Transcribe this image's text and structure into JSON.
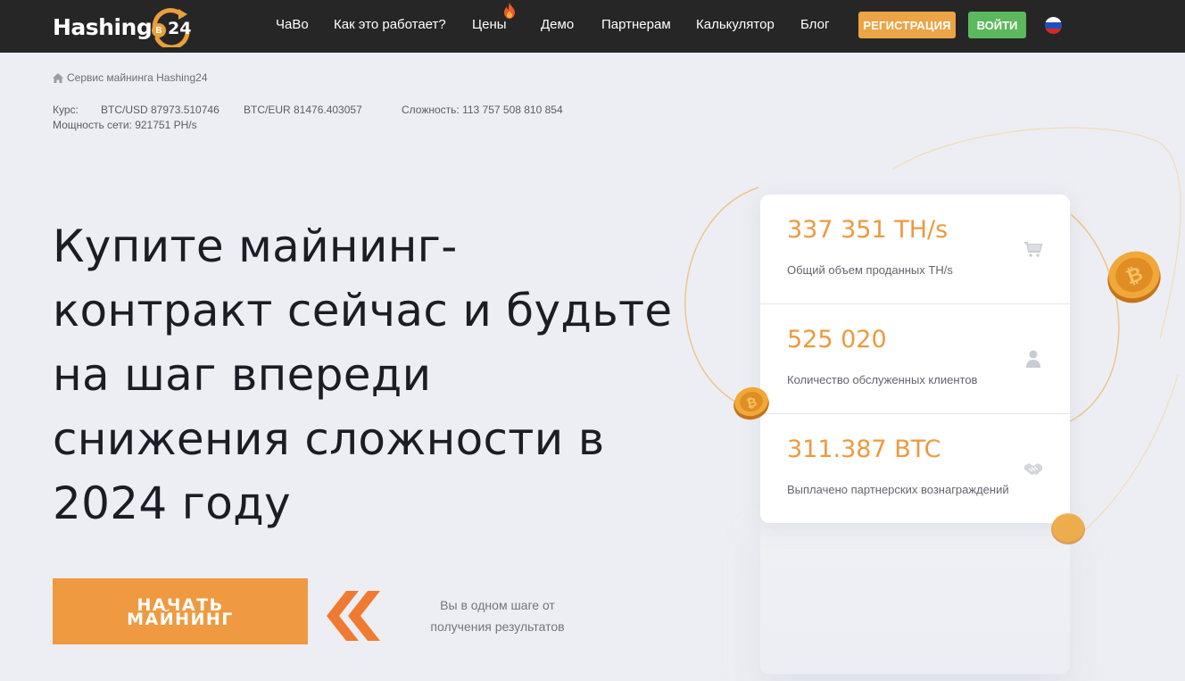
{
  "header": {
    "logo_text": "Hashing",
    "logo_number": "24",
    "logo_coin": "B",
    "nav": [
      {
        "label": "ЧаВо"
      },
      {
        "label": "Как это работает?"
      },
      {
        "label": "Цены"
      },
      {
        "label": "Демо"
      },
      {
        "label": "Партнерам"
      },
      {
        "label": "Калькулятор"
      },
      {
        "label": "Блог"
      }
    ],
    "register_label": "РЕГИСТРАЦИЯ",
    "login_label": "ВОЙТИ",
    "language_icon": "russia-flag-icon"
  },
  "breadcrumb": {
    "icon": "home-icon",
    "label": "Сервис майнинга Hashing24"
  },
  "rates": {
    "rate_label": "Курс:",
    "btc_usd": "BTC/USD 87973.510746",
    "btc_eur": "BTC/EUR 81476.403057",
    "difficulty": "Сложность: 113 757 508 810 854",
    "hashrate": "Мощность сети: 921751 PH/s"
  },
  "hero": {
    "title": "Купите майнинг-контракт сейчас и будьте на шаг впереди снижения сложности в 2024 году",
    "cta_line1": "НАЧАТЬ",
    "cta_line2": "МАЙНИНГ",
    "note_line1": "Вы в одном шаге от",
    "note_line2": "получения результатов"
  },
  "stats": [
    {
      "value": "337 351 TH/s",
      "label": "Общий объем проданных TH/s",
      "icon": "cart-icon"
    },
    {
      "value": "525 020",
      "label": "Количество обслуженных клиентов",
      "icon": "user-icon"
    },
    {
      "value": "311.387 BTC",
      "label": "Выплачено партнерских вознаграждений",
      "icon": "handshake-icon"
    }
  ],
  "colors": {
    "header_bg": "#262626",
    "accent_orange": "#ec9a3e",
    "login_green": "#5cb85c",
    "page_bg": "#eceef3"
  }
}
